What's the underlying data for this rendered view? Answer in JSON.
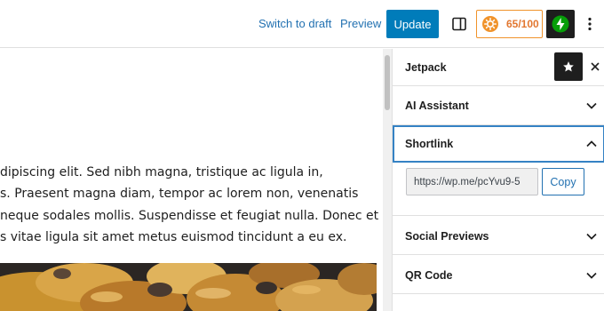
{
  "toolbar": {
    "switch_to_draft": "Switch to draft",
    "preview": "Preview",
    "update": "Update",
    "score": "65/100",
    "accent": "#007cba",
    "score_color": "#f0932b"
  },
  "editor": {
    "paragraph_lines": [
      "dipiscing elit. Sed nibh magna, tristique ac ligula in,",
      "s. Praesent magna diam, tempor ac lorem non, venenatis",
      "neque sodales mollis. Suspendisse et feugiat nulla. Donec et",
      "s vitae ligula sit amet metus euismod tincidunt a eu ex."
    ]
  },
  "sidebar": {
    "title": "Jetpack",
    "panels": [
      {
        "label": "AI Assistant",
        "state": "collapsed"
      },
      {
        "label": "Shortlink",
        "state": "expanded"
      },
      {
        "label": "Social Previews",
        "state": "collapsed"
      },
      {
        "label": "QR Code",
        "state": "collapsed"
      }
    ],
    "shortlink": {
      "value": "https://wp.me/pcYvu9-5",
      "copy_label": "Copy"
    }
  },
  "icons": {
    "sidebar_toggle": "sidebar-toggle-icon",
    "score": "sun-gear-icon",
    "jetpack": "jetpack-bolt-icon",
    "more": "more-vertical-icon",
    "star": "star-icon",
    "close": "close-icon"
  }
}
